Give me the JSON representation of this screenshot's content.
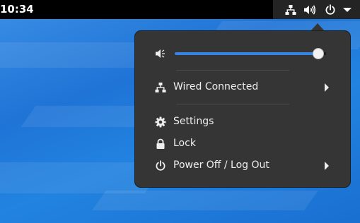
{
  "top_bar": {
    "clock": "10:34",
    "tray_icons": [
      "network-wired-icon",
      "volume-high-icon",
      "power-icon",
      "menu-down-arrow-icon"
    ]
  },
  "menu": {
    "volume": {
      "icon": "volume-low-icon",
      "level": 0.95
    },
    "network": {
      "icon": "network-wired-icon",
      "label": "Wired Connected"
    },
    "items": [
      {
        "icon": "gear-icon",
        "label": "Settings"
      },
      {
        "icon": "lock-icon",
        "label": "Lock"
      },
      {
        "icon": "power-icon",
        "label": "Power Off / Log Out"
      }
    ]
  },
  "colors": {
    "accent": "#3584e4",
    "menu_bg": "#353535",
    "top_bar_bg": "#000000",
    "wallpaper": "#1f74d6"
  }
}
